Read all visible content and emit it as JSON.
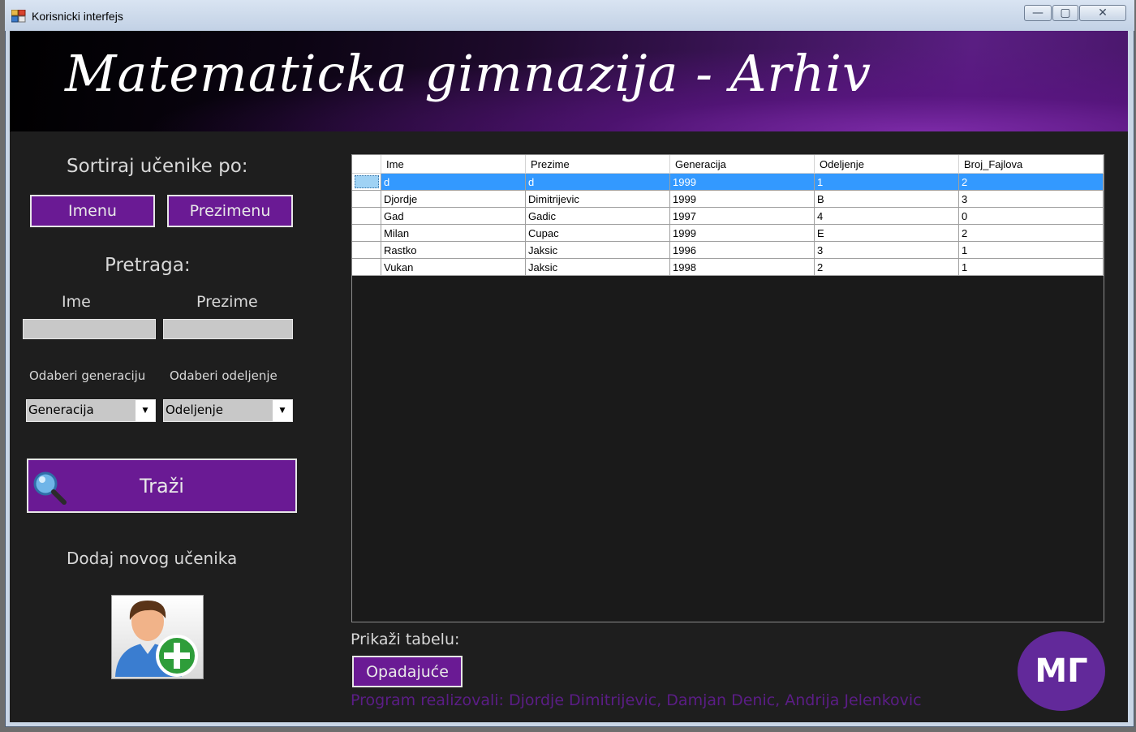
{
  "window": {
    "title": "Korisnicki interfejs",
    "minimize_glyph": "—",
    "maximize_glyph": "▢",
    "close_glyph": "✕"
  },
  "banner": {
    "title": "Matematicka gimnazija - Arhiv"
  },
  "sort": {
    "heading": "Sortiraj učenike po:",
    "by_name_label": "Imenu",
    "by_surname_label": "Prezimenu"
  },
  "search": {
    "heading": "Pretraga:",
    "name_label": "Ime",
    "surname_label": "Prezime",
    "name_value": "",
    "surname_value": "",
    "generation_label": "Odaberi generaciju",
    "class_label": "Odaberi odeljenje",
    "generation_selected": "Generacija",
    "class_selected": "Odeljenje",
    "search_button_label": "Traži"
  },
  "add_student": {
    "heading": "Dodaj novog učenika"
  },
  "table": {
    "columns": [
      "Ime",
      "Prezime",
      "Generacija",
      "Odeljenje",
      "Broj_Fajlova"
    ],
    "rows": [
      [
        "d",
        "d",
        "1999",
        "1",
        "2"
      ],
      [
        "Djordje",
        "Dimitrijevic",
        "1999",
        "B",
        "3"
      ],
      [
        "Gad",
        "Gadic",
        "1997",
        "4",
        "0"
      ],
      [
        "Milan",
        "Cupac",
        "1999",
        "E",
        "2"
      ],
      [
        "Rastko",
        "Jaksic",
        "1996",
        "3",
        "1"
      ],
      [
        "Vukan",
        "Jaksic",
        "1998",
        "2",
        "1"
      ]
    ],
    "selected_row_index": 0
  },
  "order": {
    "heading": "Prikaži tabelu:",
    "button_label": "Opadajuće"
  },
  "footer": {
    "credits": "Program realizovali: Djordje Dimitrijevic, Damjan Denic, Andrija Jelenkovic",
    "logo_text": "МГ"
  },
  "colors": {
    "accent_purple": "#6a1a94",
    "background": "#1e1e1e",
    "selection_blue": "#3399ff"
  }
}
